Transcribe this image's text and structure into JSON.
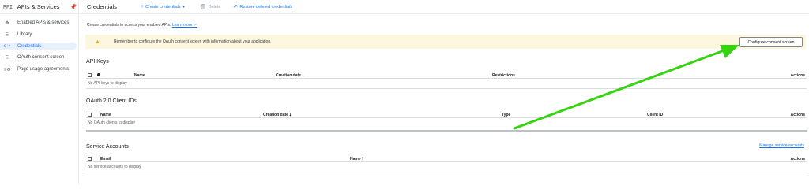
{
  "sidebar": {
    "logo": "RPI",
    "title": "APIs & Services",
    "items": [
      {
        "label": "Enabled APIs & services",
        "icon": "✥"
      },
      {
        "label": "Library",
        "icon": "⠿"
      },
      {
        "label": "Credentials",
        "icon": "o⊸"
      },
      {
        "label": "OAuth consent screen",
        "icon": "⠿"
      },
      {
        "label": "Page usage agreements",
        "icon": "≡⚙"
      }
    ]
  },
  "toolbar": {
    "title": "Credentials",
    "create_label": "Create credentials",
    "delete_label": "Delete",
    "restore_label": "Restore deleted credentials"
  },
  "intro": {
    "text": "Create credentials to access your enabled APIs.",
    "link": "Learn more ↗"
  },
  "banner": {
    "text": "Remember to configure the OAuth consent screen with information about your application.",
    "button": "Configure consent screen"
  },
  "api_keys": {
    "title": "API Keys",
    "columns": [
      "Name",
      "Creation date",
      "Restrictions",
      "Actions"
    ],
    "empty": "No API keys to display"
  },
  "oauth": {
    "title": "OAuth 2.0 Client IDs",
    "columns": [
      "Name",
      "Creation date",
      "Type",
      "Client ID",
      "Actions"
    ],
    "empty": "No OAuth clients to display"
  },
  "service_accounts": {
    "title": "Service Accounts",
    "manage_link": "Manage service accounts",
    "columns": [
      "Email",
      "Name",
      "Actions"
    ],
    "empty": "No service accounts to display"
  },
  "annotation": {
    "color": "#34d40f"
  }
}
